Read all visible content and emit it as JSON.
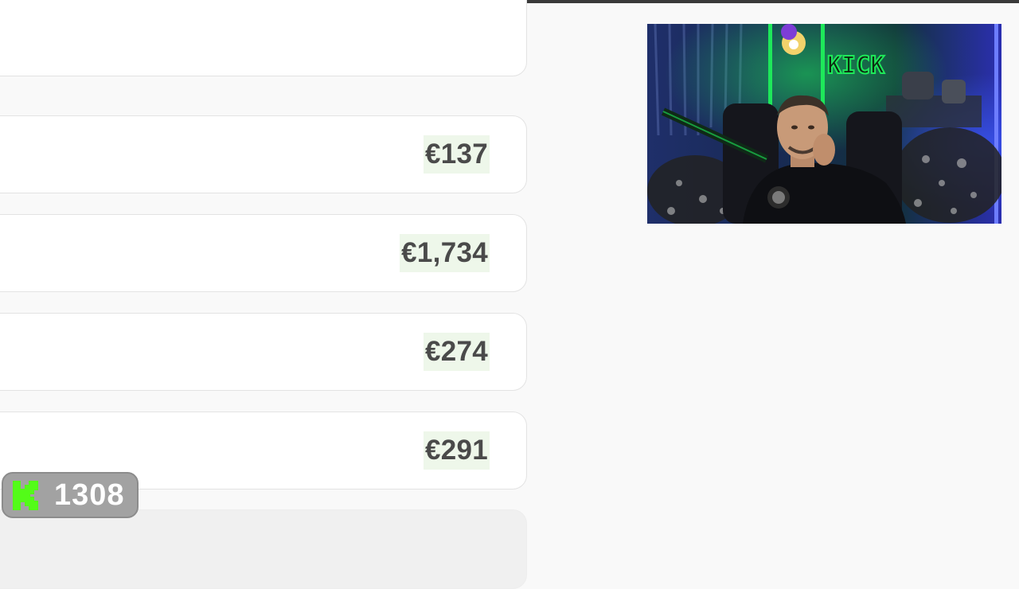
{
  "rows": [
    {
      "amount": "€137"
    },
    {
      "amount": "€1,734"
    },
    {
      "amount": "€274"
    },
    {
      "amount": "€291"
    }
  ],
  "webcam": {
    "sign_text": "KICK",
    "accent_color": "#1ee85a"
  },
  "kick_badge": {
    "icon": "kick-logo-icon",
    "count": "1308",
    "accent_color": "#53fc18"
  }
}
